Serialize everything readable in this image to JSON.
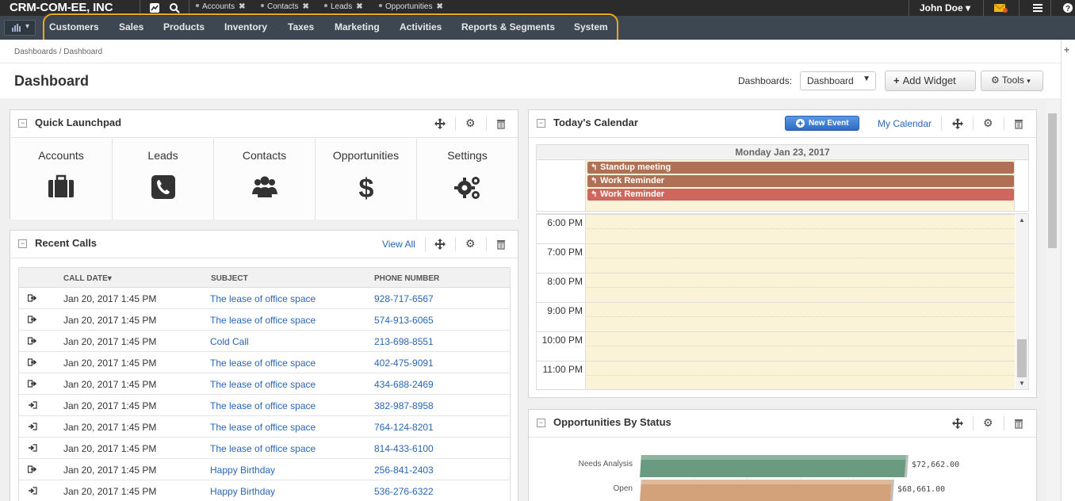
{
  "app": {
    "brand": "CRM-COM-EE, INC",
    "user": "John Doe"
  },
  "open_tabs": [
    {
      "label": "Accounts"
    },
    {
      "label": "Contacts"
    },
    {
      "label": "Leads"
    },
    {
      "label": "Opportunities"
    }
  ],
  "nav": [
    "Customers",
    "Sales",
    "Products",
    "Inventory",
    "Taxes",
    "Marketing",
    "Activities",
    "Reports & Segments",
    "System"
  ],
  "breadcrumb": "Dashboards / Dashboard",
  "page": {
    "title": "Dashboard",
    "dashboards_label": "Dashboards:",
    "dashboard_select": "Dashboard",
    "add_widget": "Add Widget",
    "tools": "Tools"
  },
  "launchpad": {
    "title": "Quick Launchpad",
    "items": [
      {
        "label": "Accounts",
        "icon": "briefcase-icon"
      },
      {
        "label": "Leads",
        "icon": "phone-icon"
      },
      {
        "label": "Contacts",
        "icon": "users-icon"
      },
      {
        "label": "Opportunities",
        "icon": "dollar-icon"
      },
      {
        "label": "Settings",
        "icon": "gears-icon"
      }
    ]
  },
  "recent_calls": {
    "title": "Recent Calls",
    "view_all": "View All",
    "columns": [
      "CALL DATE",
      "SUBJECT",
      "PHONE NUMBER"
    ],
    "rows": [
      {
        "dir": "outgoing",
        "date": "Jan 20, 2017 1:45 PM",
        "subject": "The lease of office space",
        "phone": "928-717-6567"
      },
      {
        "dir": "outgoing",
        "date": "Jan 20, 2017 1:45 PM",
        "subject": "The lease of office space",
        "phone": "574-913-6065"
      },
      {
        "dir": "outgoing",
        "date": "Jan 20, 2017 1:45 PM",
        "subject": "Cold Call",
        "phone": "213-698-8551"
      },
      {
        "dir": "outgoing",
        "date": "Jan 20, 2017 1:45 PM",
        "subject": "The lease of office space",
        "phone": "402-475-9091"
      },
      {
        "dir": "outgoing",
        "date": "Jan 20, 2017 1:45 PM",
        "subject": "The lease of office space",
        "phone": "434-688-2469"
      },
      {
        "dir": "incoming",
        "date": "Jan 20, 2017 1:45 PM",
        "subject": "The lease of office space",
        "phone": "382-987-8958"
      },
      {
        "dir": "incoming",
        "date": "Jan 20, 2017 1:45 PM",
        "subject": "The lease of office space",
        "phone": "764-124-8201"
      },
      {
        "dir": "incoming",
        "date": "Jan 20, 2017 1:45 PM",
        "subject": "The lease of office space",
        "phone": "814-433-6100"
      },
      {
        "dir": "outgoing",
        "date": "Jan 20, 2017 1:45 PM",
        "subject": "Happy Birthday",
        "phone": "256-841-2403"
      },
      {
        "dir": "incoming",
        "date": "Jan 20, 2017 1:45 PM",
        "subject": "Happy Birthday",
        "phone": "536-276-6322"
      }
    ]
  },
  "calendar": {
    "title": "Today's Calendar",
    "new_event": "New Event",
    "my_calendar": "My Calendar",
    "day": "Monday Jan 23, 2017",
    "events": [
      {
        "label": "Standup meeting",
        "color": "#b07055"
      },
      {
        "label": "Work Reminder",
        "color": "#b07055"
      },
      {
        "label": "Work Reminder",
        "color": "#d0675e"
      }
    ],
    "hours": [
      "6:00 PM",
      "7:00 PM",
      "8:00 PM",
      "9:00 PM",
      "10:00 PM",
      "11:00 PM"
    ]
  },
  "opportunities": {
    "title": "Opportunities By Status",
    "chart_data": {
      "type": "bar",
      "orientation": "horizontal",
      "categories": [
        "Needs Analysis",
        "Open"
      ],
      "values": [
        72662.0,
        68661.0
      ],
      "value_labels": [
        "$72,662.00",
        "$68,661.00"
      ],
      "colors": [
        "#6a9a80",
        "#d4a27a"
      ]
    }
  },
  "colors": {
    "nav_bg": "#3d4752",
    "topbar_bg": "#2b2b2b",
    "link": "#2a66b5",
    "highlight": "#f0a818",
    "new_event_bg": "#3a7bd5"
  }
}
